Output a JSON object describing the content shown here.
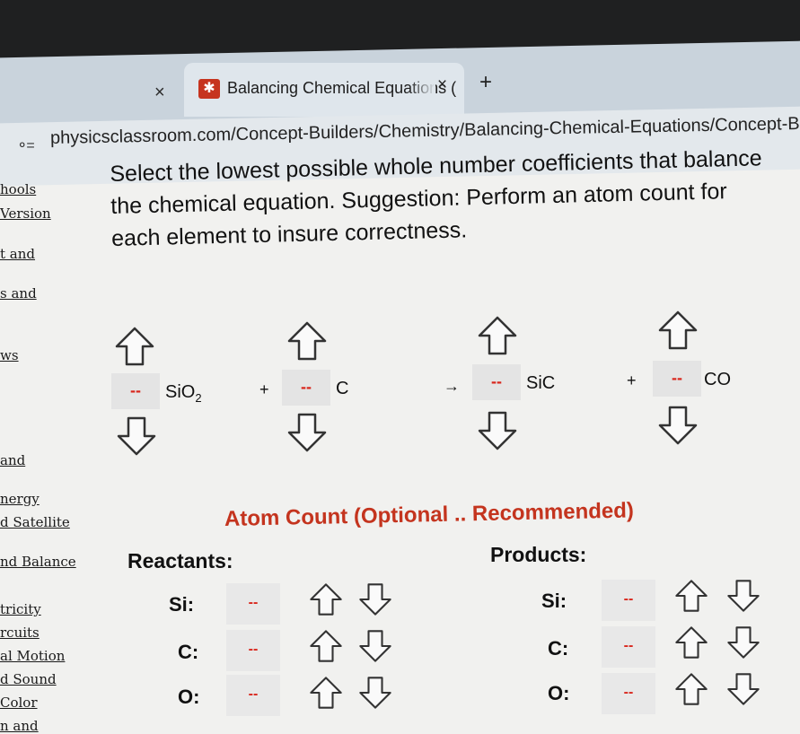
{
  "browser": {
    "tab_close_left": "×",
    "favicon": "✱",
    "tab_title": "Balancing Chemical Equations (",
    "tab_close": "×",
    "new_tab": "+",
    "site_icon": "⚬=",
    "url": "physicsclassroom.com/Concept-Builders/Chemistry/Balancing-Chemical-Equations/Concept-Builder"
  },
  "sidebar": {
    "items": [
      "hools",
      "Version",
      "t and",
      "s and",
      "ws",
      "and",
      "nergy",
      "d Satellite",
      "nd Balance",
      "tricity",
      "rcuits",
      "al Motion",
      "d Sound",
      "Color",
      "n and"
    ]
  },
  "instructions": "Select the lowest possible whole number coefficients that balance the chemical equation.   Suggestion: Perform an atom count for each element to insure correctness.",
  "equation": {
    "terms": [
      {
        "coef": "--",
        "formula": "SiO",
        "sub": "2"
      },
      {
        "coef": "--",
        "formula": "C",
        "sub": ""
      },
      {
        "coef": "--",
        "formula": "SiC",
        "sub": ""
      },
      {
        "coef": "--",
        "formula": "CO",
        "sub": ""
      }
    ],
    "plus": "+",
    "arrow": "→"
  },
  "atom_count": {
    "title": "Atom Count (Optional .. Recommended)",
    "reactants_label": "Reactants:",
    "products_label": "Products:",
    "reactants": [
      {
        "element": "Si:",
        "value": "--"
      },
      {
        "element": "C:",
        "value": "--"
      },
      {
        "element": "O:",
        "value": "--"
      }
    ],
    "products": [
      {
        "element": "Si:",
        "value": "--"
      },
      {
        "element": "C:",
        "value": "--"
      },
      {
        "element": "O:",
        "value": "--"
      }
    ]
  },
  "colors": {
    "accent_red": "#d9261c",
    "title_red": "#c4341e",
    "coef_box": "#e4e4e4"
  }
}
